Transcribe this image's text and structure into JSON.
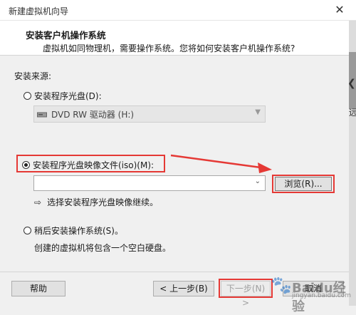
{
  "window": {
    "title": "新建虚拟机向导",
    "close_glyph": "✕"
  },
  "header": {
    "title": "安装客户机操作系统",
    "subtitle": "虚拟机如同物理机，需要操作系统。您将如何安装客户机操作系统?"
  },
  "side_edge": {
    "arrow_glyph": "❮",
    "char": "远"
  },
  "install_source": {
    "label": "安装来源:",
    "options": [
      {
        "label": "安装程序光盘(D):",
        "selected": false
      },
      {
        "label": "安装程序光盘映像文件(iso)(M):",
        "selected": true
      },
      {
        "label": "稍后安装操作系统(S)。",
        "selected": false
      }
    ],
    "disc_drive_value": "DVD RW 驱动器 (H:)",
    "iso_path_value": "",
    "browse_label": "浏览(R)...",
    "iso_hint": "选择安装程序光盘映像继续。",
    "later_description": "创建的虚拟机将包含一个空白硬盘。"
  },
  "footer": {
    "help_label": "帮助",
    "back_label": "< 上一步(B)",
    "next_label": "下一步(N) >",
    "cancel_label": "取消"
  },
  "icons": {
    "window_close": "close-icon",
    "disc_drive": "dvd-drive-icon",
    "dropdown": "chevron-down-icon",
    "hint": "arrow-right-icon"
  },
  "colors": {
    "highlight": "#e53935",
    "accent_border": "#333333"
  },
  "watermark": {
    "text": "Baidu经验",
    "sub": "jingyan.baidu.com"
  }
}
